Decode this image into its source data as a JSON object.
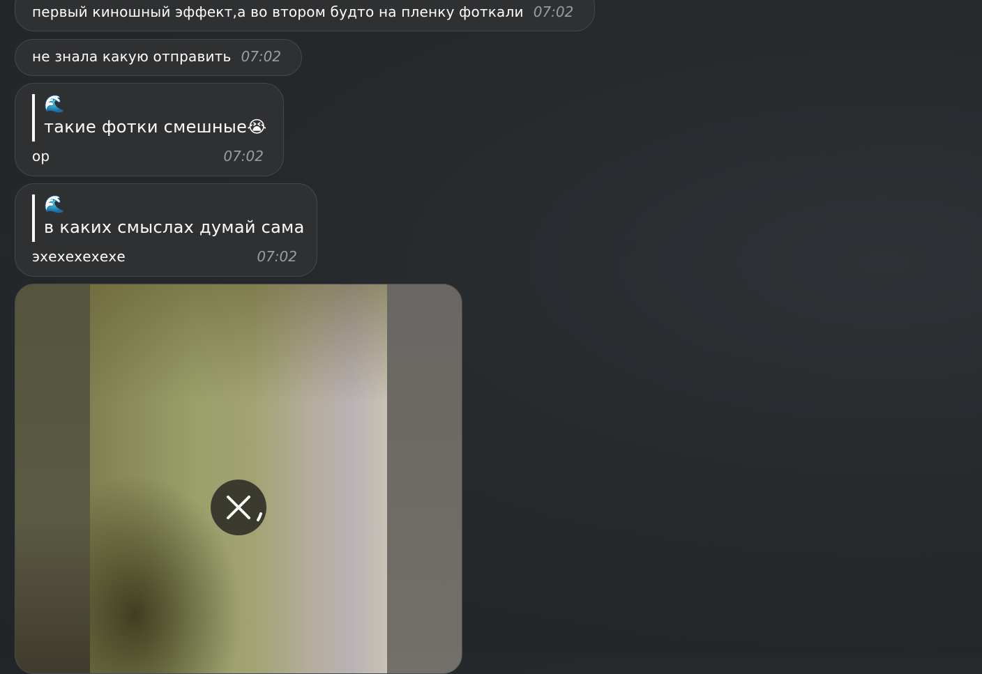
{
  "messages": [
    {
      "text": "первый киношный эффект,а во втором будто на пленку фоткали",
      "time": "07:02"
    },
    {
      "text": "не знала какую отправить",
      "time": "07:02"
    },
    {
      "quote_emoji": "🌊",
      "quote_text": "такие фотки смешные😭",
      "text": "ор",
      "time": "07:02"
    },
    {
      "quote_emoji": "🌊",
      "quote_text": "в каких смыслах думай сама",
      "text": "эхехехехехе",
      "time": "07:02"
    }
  ],
  "media_message": {
    "icons": {
      "close": "close-icon",
      "progress": "loading-arc-icon"
    }
  },
  "colors": {
    "background": "#26292c",
    "bubble": "#2f3032",
    "time": "#9a9ca1",
    "text": "#ffffff"
  }
}
